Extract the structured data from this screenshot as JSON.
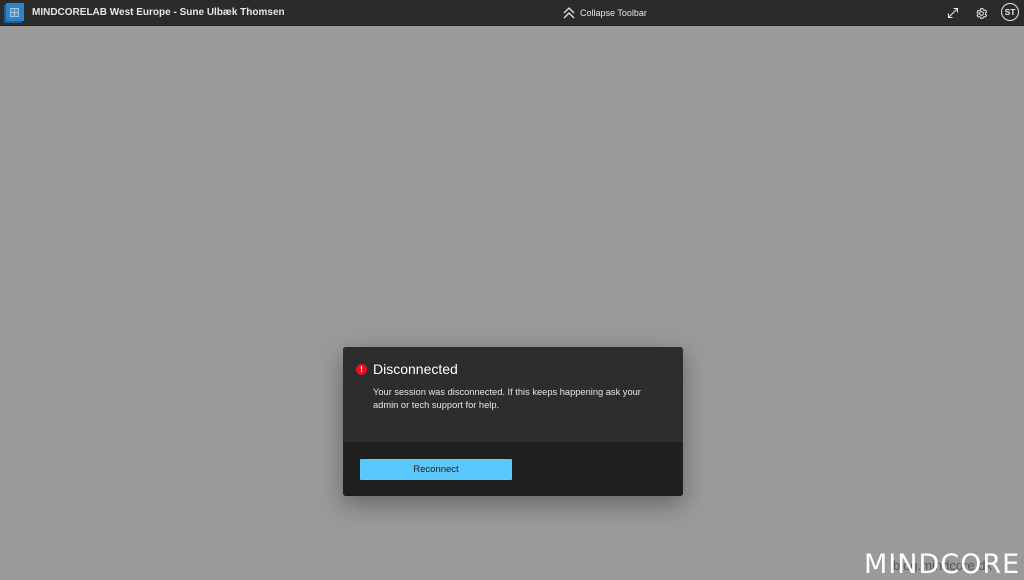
{
  "toolbar": {
    "title": "MINDCORELAB West Europe - Sune Ulbæk Thomsen",
    "collapse_label": "Collapse Toolbar",
    "avatar_initials": "ST"
  },
  "dialog": {
    "title": "Disconnected",
    "message": "Your session was disconnected. If this keeps happening ask your admin or tech support for help.",
    "reconnect_label": "Reconnect",
    "error_glyph": "!"
  },
  "watermark": {
    "logo_text": "MINDCORE",
    "sub_text": "blog.mindcore.dk"
  },
  "colors": {
    "toolbar_bg": "#2b2b2b",
    "canvas_bg": "#9a9a9a",
    "dialog_bg": "#2d2d2d",
    "dialog_footer_bg": "#1f1f1f",
    "accent": "#5ac8fa",
    "error": "#e81123"
  },
  "icons": [
    "windows-app-logo-icon",
    "chevron-up-double-icon",
    "expand-icon",
    "gear-icon",
    "error-icon"
  ]
}
